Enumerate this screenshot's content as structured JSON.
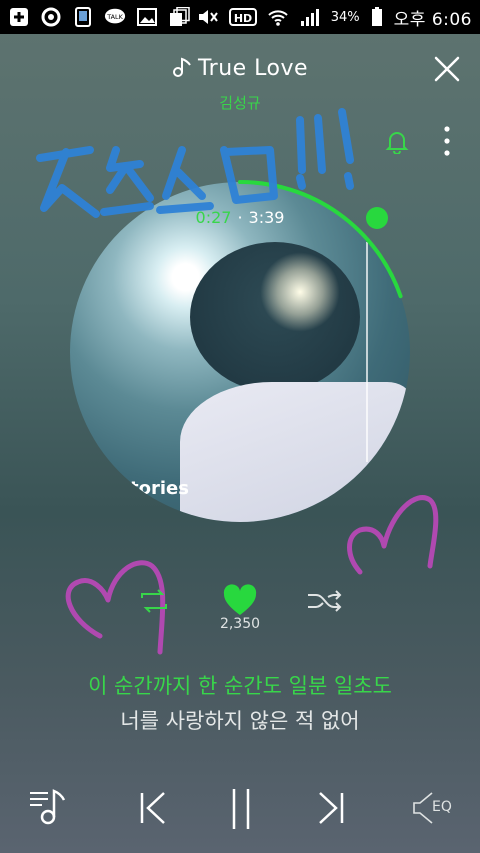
{
  "status_bar": {
    "battery_percent": "34%",
    "time": "오후 6:06",
    "icons": [
      "plus-icon",
      "circle-icon",
      "phone-icon",
      "talk-icon",
      "image-icon",
      "cards-icon",
      "mute-icon",
      "hd-icon",
      "wifi-icon",
      "signal-icon",
      "battery-icon"
    ],
    "talk_label": "TALK",
    "hd_label": "HD"
  },
  "player": {
    "song_title": "True Love",
    "artist": "김성규",
    "time_current": "0:27",
    "time_separator": "·",
    "time_total": "3:39",
    "progress_fraction": 0.123,
    "album_text": "tories",
    "like_count": "2,350",
    "lyrics": {
      "current": "이 순간까지 한 순간도 일분 일초도",
      "next": "너를 사랑하지 않은 적 없어"
    },
    "eq_label": "EQ"
  },
  "colors": {
    "accent": "#38d64a",
    "doodle_blue": "#2f82d6",
    "doodle_magenta": "#b049b0"
  }
}
